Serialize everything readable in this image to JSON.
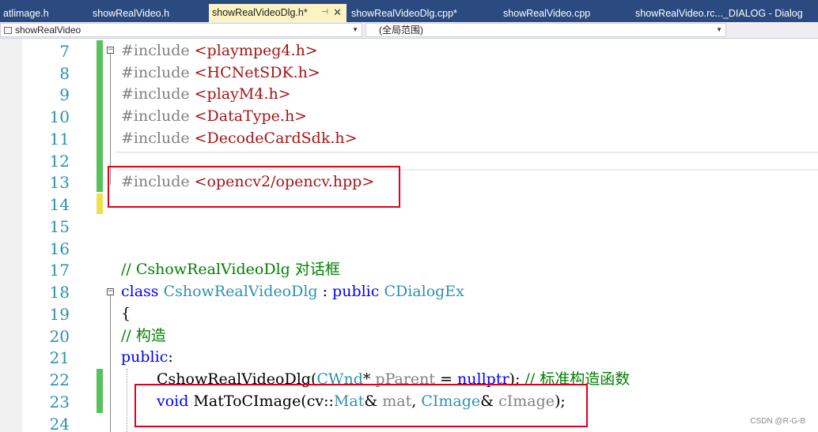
{
  "tabs": [
    {
      "label": "atlimage.h"
    },
    {
      "label": "showRealVideo.h"
    },
    {
      "label": "showRealVideoDlg.h*",
      "active": true
    },
    {
      "label": "showRealVideoDlg.cpp*"
    },
    {
      "label": "showRealVideo.cpp"
    },
    {
      "label": "showRealVideo.rc..._DIALOG - Dialog"
    }
  ],
  "navbar": {
    "project_combo": "showRealVideo",
    "scope_combo": "(全局范围)"
  },
  "line_numbers": [
    "7",
    "8",
    "9",
    "10",
    "11",
    "12",
    "13",
    "14",
    "15",
    "16",
    "17",
    "18",
    "19",
    "20",
    "21",
    "22",
    "23",
    "24"
  ],
  "code": {
    "l7_pp": "#include ",
    "l7_file": "<plaympeg4.h>",
    "l8_pp": "#include ",
    "l8_file": "<HCNetSDK.h>",
    "l9_pp": "#include ",
    "l9_file": "<playM4.h>",
    "l10_pp": "#include ",
    "l10_file": "<DataType.h>",
    "l11_pp": "#include ",
    "l11_file": "<DecodeCardSdk.h>",
    "l13_pp": "#include ",
    "l13_file": "<opencv2/opencv.hpp>",
    "l17_comment": "// CshowRealVideoDlg 对话框",
    "l18_kw_class": "class",
    "l18_name": "CshowRealVideoDlg",
    "l18_colon": " : ",
    "l18_kw_public": "public",
    "l18_base": "CDialogEx",
    "l19_brace": "{",
    "l20_comment": "// 构造",
    "l21_public": "public",
    "l21_colon": ":",
    "l22_ctor": "CshowRealVideoDlg(",
    "l22_cwnd": "CWnd",
    "l22_star": "* ",
    "l22_param": "pParent",
    "l22_eq": " = ",
    "l22_null": "nullptr",
    "l22_end": "); ",
    "l22_comment": "// 标准构造函数",
    "l23_void": "void",
    "l23_fn": " MatToCImage(cv::",
    "l23_mat": "Mat",
    "l23_amp": "& ",
    "l23_p1": "mat",
    "l23_comma": ", ",
    "l23_cimage": "CImage",
    "l23_amp2": "& ",
    "l23_p2": "cImage",
    "l23_end": ");"
  },
  "watermark": "CSDN @R-G-B",
  "colors": {
    "tabbar_bg": "#2b4a80",
    "active_tab_bg": "#fbf3c4",
    "line_number": "#2b91af",
    "keyword": "#0000ff",
    "string": "#a31515",
    "comment": "#008000",
    "type": "#2b91af",
    "highlight_box": "#e0001c"
  }
}
